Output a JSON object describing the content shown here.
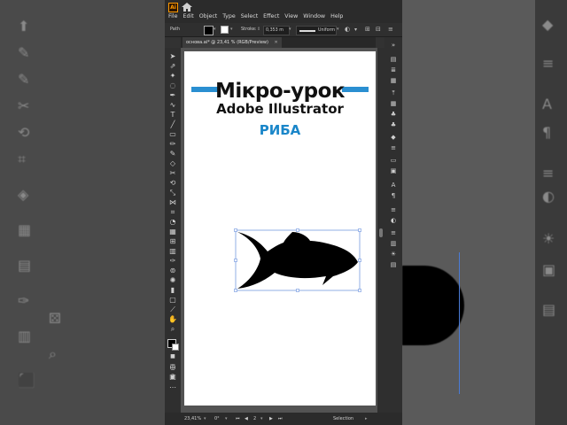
{
  "app": {
    "logo_text": "Ai",
    "menu": [
      "File",
      "Edit",
      "Object",
      "Type",
      "Select",
      "Effect",
      "View",
      "Window",
      "Help"
    ]
  },
  "controlbar": {
    "selection_label": "Path",
    "stroke_label": "Stroke:",
    "stroke_value": "0,353 m",
    "stroke_style": "Uniform"
  },
  "document": {
    "tab_label": "основа.ai* @ 23,41 % (RGB/Preview)"
  },
  "artboard": {
    "title": "Мікро-урок",
    "subtitle": "Adobe Illustrator",
    "topic": "РИБА"
  },
  "status": {
    "zoom": "23,41%",
    "rotation": "0°",
    "page": "2",
    "tool": "Selection"
  },
  "colors": {
    "accent_blue": "#2a8fd1",
    "topic_blue": "#1a86c9",
    "brand_orange": "#ff9a00",
    "selection_blue": "#4a7bd6"
  }
}
